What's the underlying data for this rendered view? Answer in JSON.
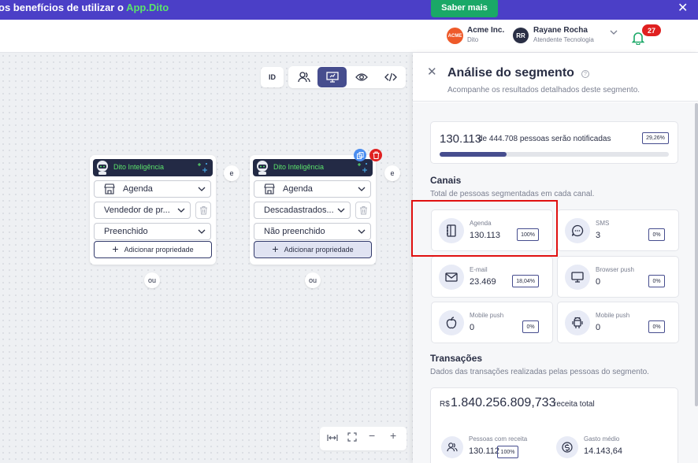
{
  "banner": {
    "text": "os benefícios de utilizar o ",
    "brand": "App.Dito",
    "cta": "Saber mais",
    "close": "✕"
  },
  "topbar": {
    "org_logo": "ACME",
    "org_name": "Acme Inc.",
    "org_sub": "Dito",
    "user_initials": "RR",
    "user_name": "Rayane Rocha",
    "user_role": "Atendente Tecnologia",
    "notifications": "27"
  },
  "toolbar": {
    "id_label": "ID"
  },
  "nodes": [
    {
      "title": "Dito Inteligência",
      "source": "Agenda",
      "property": "Vendedor de pr...",
      "condition": "Preenchido",
      "add_label": "Adicionar propriedade",
      "connector": "e",
      "or": "ou"
    },
    {
      "title": "Dito Inteligência",
      "source": "Agenda",
      "property": "Descadastrados...",
      "condition": "Não preenchido",
      "add_label": "Adicionar propriedade",
      "connector": "e",
      "or": "ou"
    }
  ],
  "panel": {
    "title": "Análise do segmento",
    "help": "?",
    "subtitle": "Acompanhe os resultados detalhados deste segmento.",
    "notified": {
      "count": "130.113",
      "rest": "de 444.708 pessoas serão notificadas",
      "percent": "29,26%",
      "fraction": 0.2926
    },
    "channels_title": "Canais",
    "channels_sub": "Total de pessoas segmentadas em cada canal.",
    "channels": [
      {
        "name": "Agenda",
        "value": "130.113",
        "pct": "100%",
        "icon": "calendar-icon"
      },
      {
        "name": "SMS",
        "value": "3",
        "pct": "0%",
        "icon": "chat-icon"
      },
      {
        "name": "E-mail",
        "value": "23.469",
        "pct": "18,04%",
        "icon": "mail-icon"
      },
      {
        "name": "Browser push",
        "value": "0",
        "pct": "0%",
        "icon": "monitor-icon"
      },
      {
        "name": "Mobile push",
        "value": "0",
        "pct": "0%",
        "icon": "apple-icon"
      },
      {
        "name": "Mobile push",
        "value": "0",
        "pct": "0%",
        "icon": "android-icon"
      }
    ],
    "transactions_title": "Transações",
    "transactions_sub": "Dados das transações realizadas pelas pessoas do segmento.",
    "revenue": {
      "currency": "R$",
      "value": "1.840.256.809,733",
      "label": "receita total"
    },
    "kpis": [
      {
        "name": "Pessoas com receita",
        "value": "130.112",
        "pct": "100%"
      },
      {
        "name": "Gasto médio",
        "value": "14.143,64"
      }
    ]
  },
  "colors": {
    "primary": "#464d8e",
    "banner": "#4b3fc7",
    "accent_green": "#1aa867",
    "highlight": "#e01010"
  }
}
